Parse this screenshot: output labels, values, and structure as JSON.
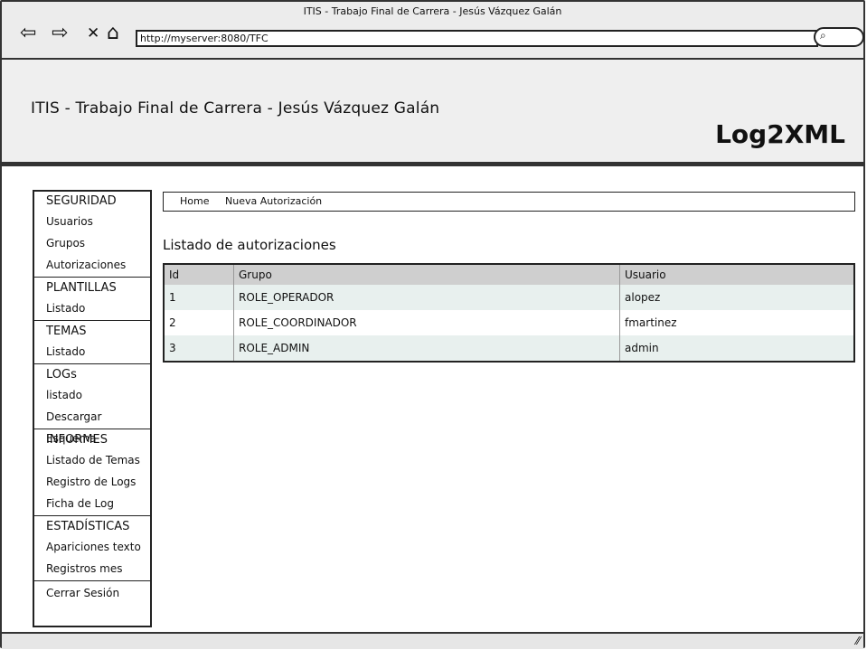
{
  "window": {
    "title": "ITIS - Trabajo Final de Carrera -  Jesús Vázquez Galán"
  },
  "browser": {
    "back_icon": "⇦",
    "forward_icon": "⇨",
    "close_icon": "✕",
    "home_icon": "⌂",
    "url": "http://myserver:8080/TFC",
    "search_icon": "⌕"
  },
  "header": {
    "title": "ITIS - Trabajo Final de Carrera - Jesús Vázquez Galán",
    "logo": "Log2XML"
  },
  "sidebar": {
    "seguridad": {
      "title": "SEGURIDAD",
      "items": [
        "Usuarios",
        "Grupos",
        "Autorizaciones"
      ]
    },
    "plantillas": {
      "title": "PLANTILLAS",
      "items": [
        "Listado"
      ]
    },
    "temas": {
      "title": "TEMAS",
      "items": [
        "Listado"
      ]
    },
    "logs": {
      "title": "LOGs",
      "items": [
        "listado",
        "Descargar Esquema"
      ]
    },
    "informes": {
      "title": "INFORMES",
      "items": [
        "Listado de Temas",
        "Registro de Logs",
        "Ficha de Log"
      ]
    },
    "estadisticas": {
      "title": "ESTADÍSTICAS",
      "items": [
        "Apariciones texto",
        "Registros mes"
      ]
    },
    "logout": "Cerrar Sesión"
  },
  "breadcrumb": {
    "home": "Home",
    "new_auth": "Nueva Autorización"
  },
  "main": {
    "title": "Listado de autorizaciones",
    "columns": [
      "Id",
      "Grupo",
      "Usuario"
    ],
    "rows": [
      [
        "1",
        "ROLE_OPERADOR",
        "alopez"
      ],
      [
        "2",
        "ROLE_COORDINADOR",
        "fmartinez"
      ],
      [
        "3",
        "ROLE_ADMIN",
        "admin"
      ]
    ]
  },
  "status": {
    "resize_icon": "⁄⁄"
  }
}
